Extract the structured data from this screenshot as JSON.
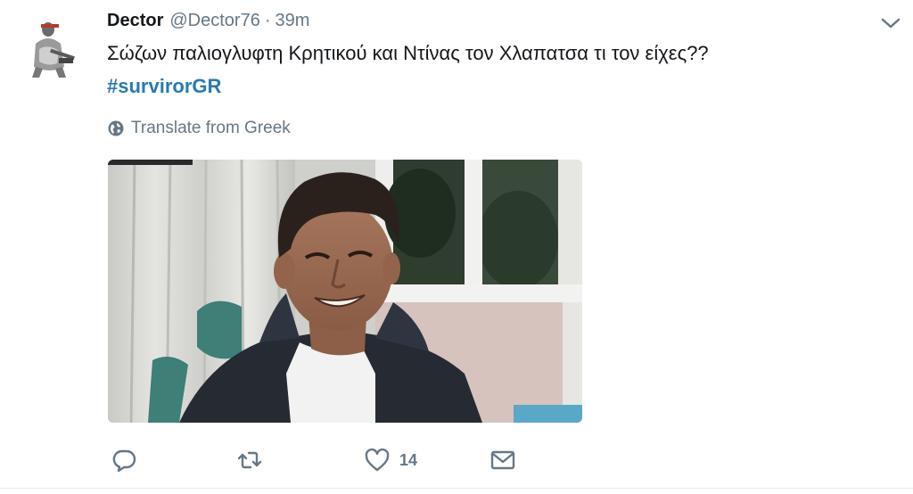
{
  "tweet": {
    "author_name": "Dector",
    "author_handle": "@Dector76",
    "separator": "·",
    "timestamp": "39m",
    "text": "Σώζων παλιογλυφτη Κρητικού και Ντίνας τον Χλαπατσα τι τον είχες??",
    "hashtag": "#survirorGR",
    "translate_label": "Translate from Greek",
    "likes_count": "14"
  },
  "icons": {
    "avatar": "avatar",
    "caret": "chevron-down-icon",
    "globe": "globe-icon",
    "reply": "reply-icon",
    "retweet": "retweet-icon",
    "like": "heart-icon",
    "dm": "envelope-icon"
  },
  "colors": {
    "text": "#14171a",
    "secondary": "#657786",
    "link": "#2a7aaf"
  }
}
